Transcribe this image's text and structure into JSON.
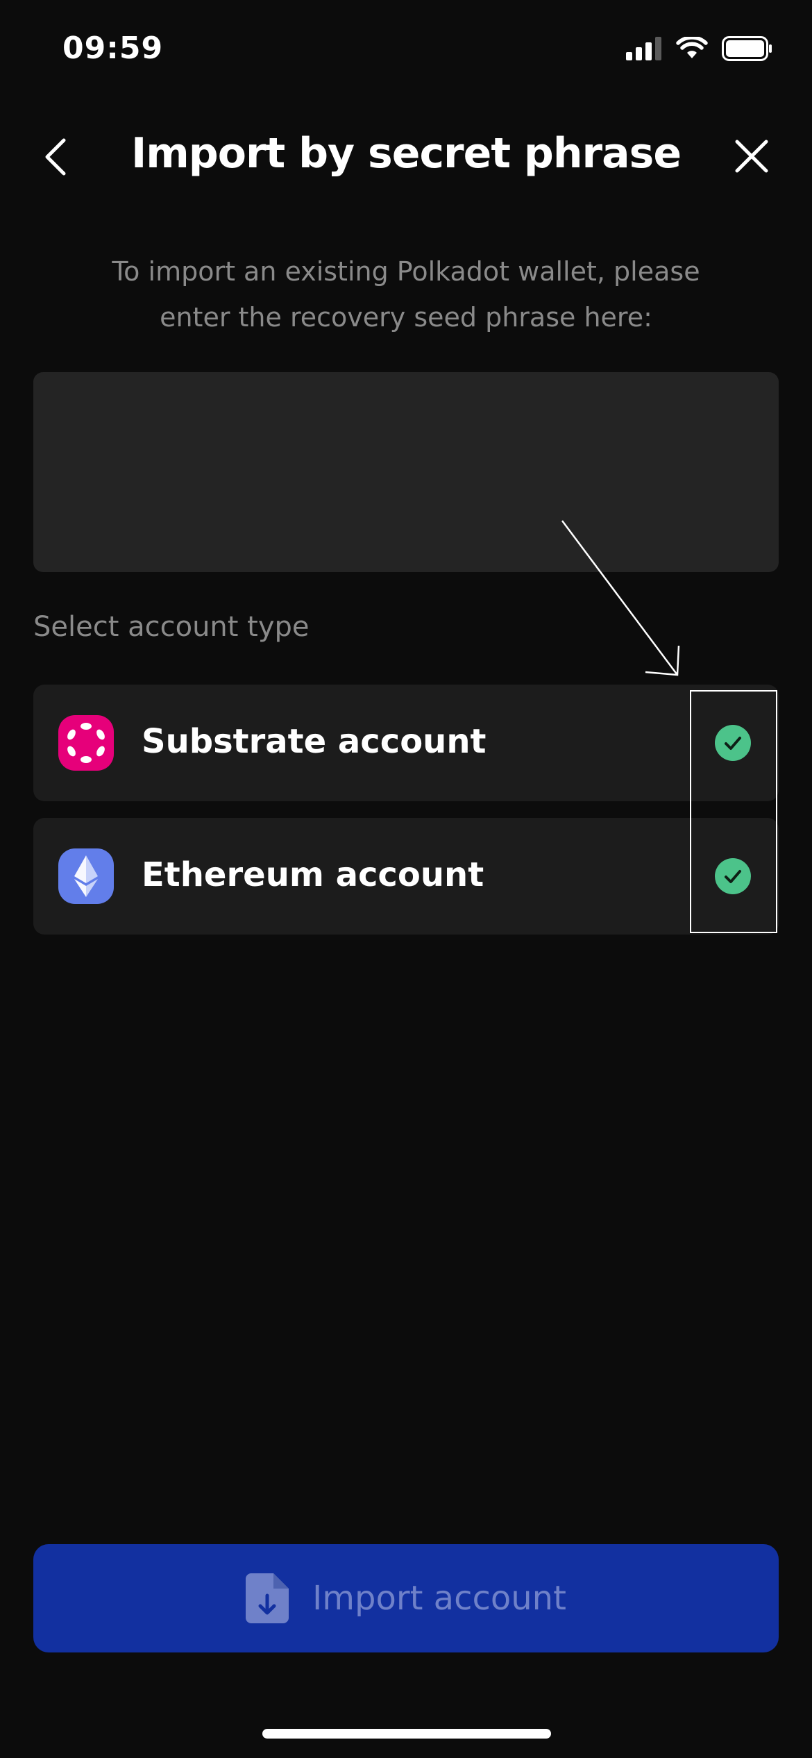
{
  "status_bar": {
    "time": "09:59",
    "icons": [
      "cellular-signal-icon",
      "wifi-icon",
      "battery-icon"
    ]
  },
  "header": {
    "title": "Import by secret phrase",
    "back_icon": "chevron-left-icon",
    "close_icon": "close-icon"
  },
  "instructions": "To import an existing Polkadot wallet, please enter the recovery seed phrase here:",
  "seed_input": {
    "value": "",
    "placeholder": ""
  },
  "account_type": {
    "label": "Select account type",
    "options": [
      {
        "label": "Substrate account",
        "icon": "polkadot-icon",
        "checked": true
      },
      {
        "label": "Ethereum account",
        "icon": "ethereum-icon",
        "checked": true
      }
    ]
  },
  "import_button": {
    "label": "Import account",
    "icon": "file-download-icon"
  },
  "colors": {
    "background": "#0c0c0c",
    "card": "#1c1c1c",
    "input": "#242424",
    "check": "#4cc38a",
    "polkadot": "#e6007a",
    "ethereum": "#627eea",
    "button": "#1230a0",
    "button_text": "#6f81c9"
  }
}
